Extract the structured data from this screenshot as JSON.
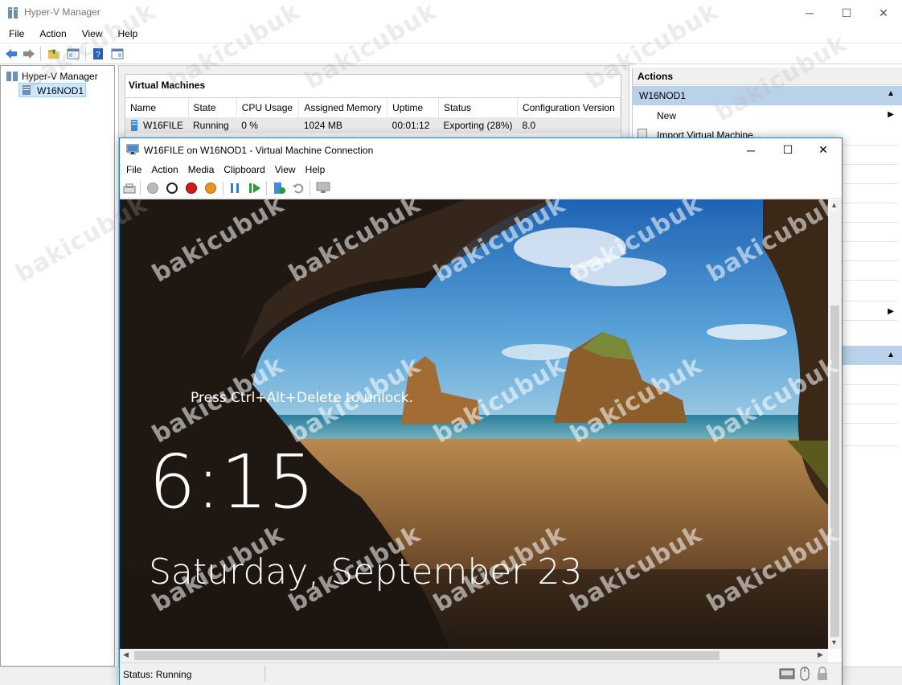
{
  "main_window": {
    "title": "Hyper-V Manager",
    "menu": [
      "File",
      "Action",
      "View",
      "Help"
    ]
  },
  "tree": {
    "root": "Hyper-V Manager",
    "server": "W16NOD1"
  },
  "vm_panel": {
    "title": "Virtual Machines",
    "columns": [
      "Name",
      "State",
      "CPU Usage",
      "Assigned Memory",
      "Uptime",
      "Status",
      "Configuration Version"
    ],
    "rows": [
      [
        "W16FILE",
        "Running",
        "0 %",
        "1024 MB",
        "00:01:12",
        "Exporting (28%)",
        "8.0"
      ]
    ]
  },
  "actions_pane": {
    "title": "Actions",
    "group": "W16NOD1",
    "items": [
      "New",
      "Import Virtual Machine..."
    ]
  },
  "vm_connection": {
    "title": "W16FILE on W16NOD1 - Virtual Machine Connection",
    "menu": [
      "File",
      "Action",
      "Media",
      "Clipboard",
      "View",
      "Help"
    ],
    "status": "Status: Running"
  },
  "lock_screen": {
    "prompt": "Press Ctrl+Alt+Delete to unlock.",
    "time": "6:15",
    "date": "Saturday, September 23"
  },
  "watermark": "bakicubuk",
  "colors": {
    "accent_border": "#1883d7",
    "selection": "#cce8ff",
    "actions_group": "#b9d1ea"
  }
}
